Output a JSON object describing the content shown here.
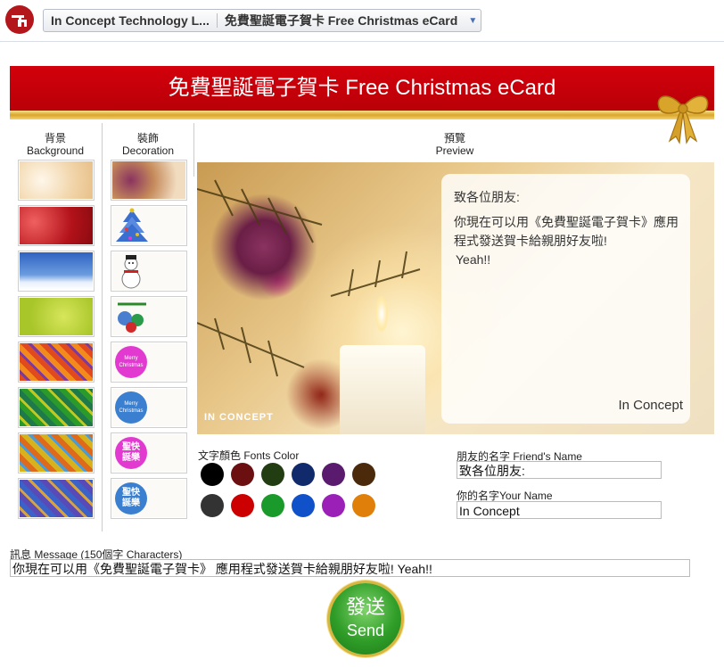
{
  "header": {
    "app_name": "In Concept Technology L...",
    "page_title": "免費聖誕電子賀卡 Free Christmas eCard"
  },
  "banner": {
    "title": "免費聖誕電子賀卡 Free Christmas eCard"
  },
  "columns": {
    "background": {
      "zh": "背景",
      "en": "Background"
    },
    "decoration": {
      "zh": "裝飾",
      "en": "Decoration"
    },
    "preview": {
      "zh": "預覽",
      "en": "Preview"
    }
  },
  "backgrounds": [
    {
      "name": "golden-bokeh",
      "colors": [
        "#f6e3c8",
        "#fff6e8"
      ]
    },
    {
      "name": "red-sparkle",
      "colors": [
        "#b3121a",
        "#e23a3a"
      ]
    },
    {
      "name": "blue-snow",
      "colors": [
        "#3b6fc9",
        "#a9c8ef"
      ]
    },
    {
      "name": "lime-green",
      "colors": [
        "#a8c62a",
        "#d7e65a"
      ]
    },
    {
      "name": "orange-pattern",
      "colors": [
        "#d9471f",
        "#7b3aa0"
      ]
    },
    {
      "name": "green-pattern",
      "colors": [
        "#2a9b2a",
        "#c3c81f"
      ]
    },
    {
      "name": "yellow-pattern",
      "colors": [
        "#d7b21d",
        "#4a9bd9"
      ]
    },
    {
      "name": "purple-pattern",
      "colors": [
        "#5a4ab8",
        "#d7a33a"
      ]
    }
  ],
  "decorations": [
    {
      "name": "bokeh-photo"
    },
    {
      "name": "christmas-tree"
    },
    {
      "name": "snowman"
    },
    {
      "name": "ornaments"
    },
    {
      "name": "merry-christmas-pink",
      "label": "Merry Christmas",
      "color": "#e23ad0"
    },
    {
      "name": "merry-christmas-blue",
      "label": "Merry Christmas",
      "color": "#3a7fd0"
    },
    {
      "name": "sheng-dan-pink",
      "label": "聖快 誕樂",
      "color": "#e23ad0"
    },
    {
      "name": "sheng-dan-blue",
      "label": "聖快 誕樂",
      "color": "#3a7fd0"
    }
  ],
  "preview": {
    "greeting": "致各位朋友:",
    "body": "你現在可以用《免費聖誕電子賀卡》應用程式發送賀卡給親朋好友啦!",
    "yeah": "Yeah!!",
    "signature": "In Concept",
    "logo_text": "IN CONCEPT"
  },
  "fonts_color": {
    "label": "文字顏色 Fonts Color",
    "colors": [
      "#000000",
      "#6b0f10",
      "#223d12",
      "#102a6b",
      "#5a1a6e",
      "#4a2a0a",
      "#333333",
      "#cc0000",
      "#1a9a2a",
      "#1050c8",
      "#9a20b8",
      "#e07f0a"
    ]
  },
  "friend_name": {
    "label": "朋友的名字 Friend's Name",
    "value": "致各位朋友:"
  },
  "your_name": {
    "label": "你的名字Your Name",
    "value": "In Concept"
  },
  "message": {
    "label": "訊息 Message (150個字 Characters)",
    "value": "你現在可以用《免費聖誕電子賀卡》 應用程式發送賀卡給親朋好友啦!  Yeah!!"
  },
  "send_button": {
    "zh": "發送",
    "en": "Send"
  }
}
